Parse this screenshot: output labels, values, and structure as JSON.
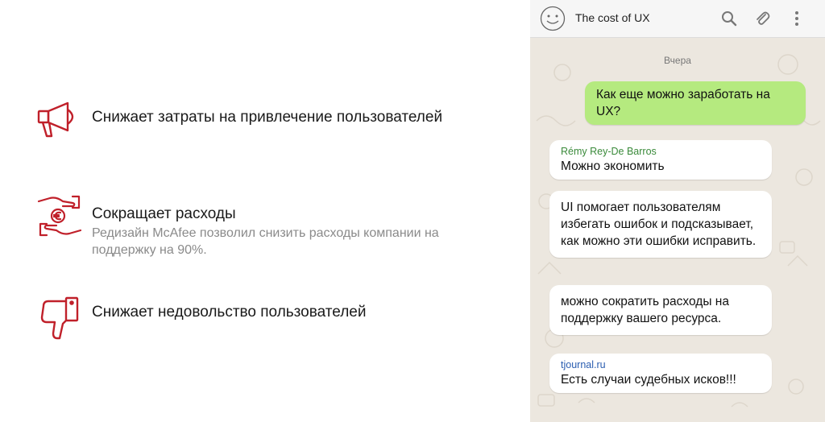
{
  "features": [
    {
      "icon": "megaphone-icon",
      "title": "Снижает затраты на привлечение пользователей",
      "desc": ""
    },
    {
      "icon": "hands-euro-icon",
      "title": "Сокращает расходы",
      "desc": "Редизайн McAfee позволил снизить расходы компании на поддержку на 90%."
    },
    {
      "icon": "thumbs-down-icon",
      "title": "Снижает недовольство пользователей",
      "desc": ""
    }
  ],
  "chat": {
    "title": "The cost of UX",
    "date_label": "Вчера",
    "messages": [
      {
        "dir": "out",
        "sender": "",
        "text": "Как еще можно заработать на UX?"
      },
      {
        "dir": "in",
        "sender": "Rémy Rey-De Barros",
        "text": "Можно экономить"
      },
      {
        "dir": "in",
        "sender": "",
        "text": "UI помогает пользователям избегать ошибок и подсказывает, как можно эти ошибки исправить."
      },
      {
        "dir": "in",
        "sender": "",
        "text": "можно сократить расходы на поддержку вашего ресурса."
      },
      {
        "dir": "in",
        "sender": "tjournal.ru",
        "text": "Есть случаи судебных исков!!!"
      }
    ]
  },
  "colors": {
    "accent_red": "#c0202a",
    "outgoing_bubble": "#b5ea7f",
    "incoming_bubble": "#ffffff",
    "chat_bg": "#ece7df",
    "sender_green": "#3a8a3a",
    "sender_blue": "#2a5db0"
  }
}
